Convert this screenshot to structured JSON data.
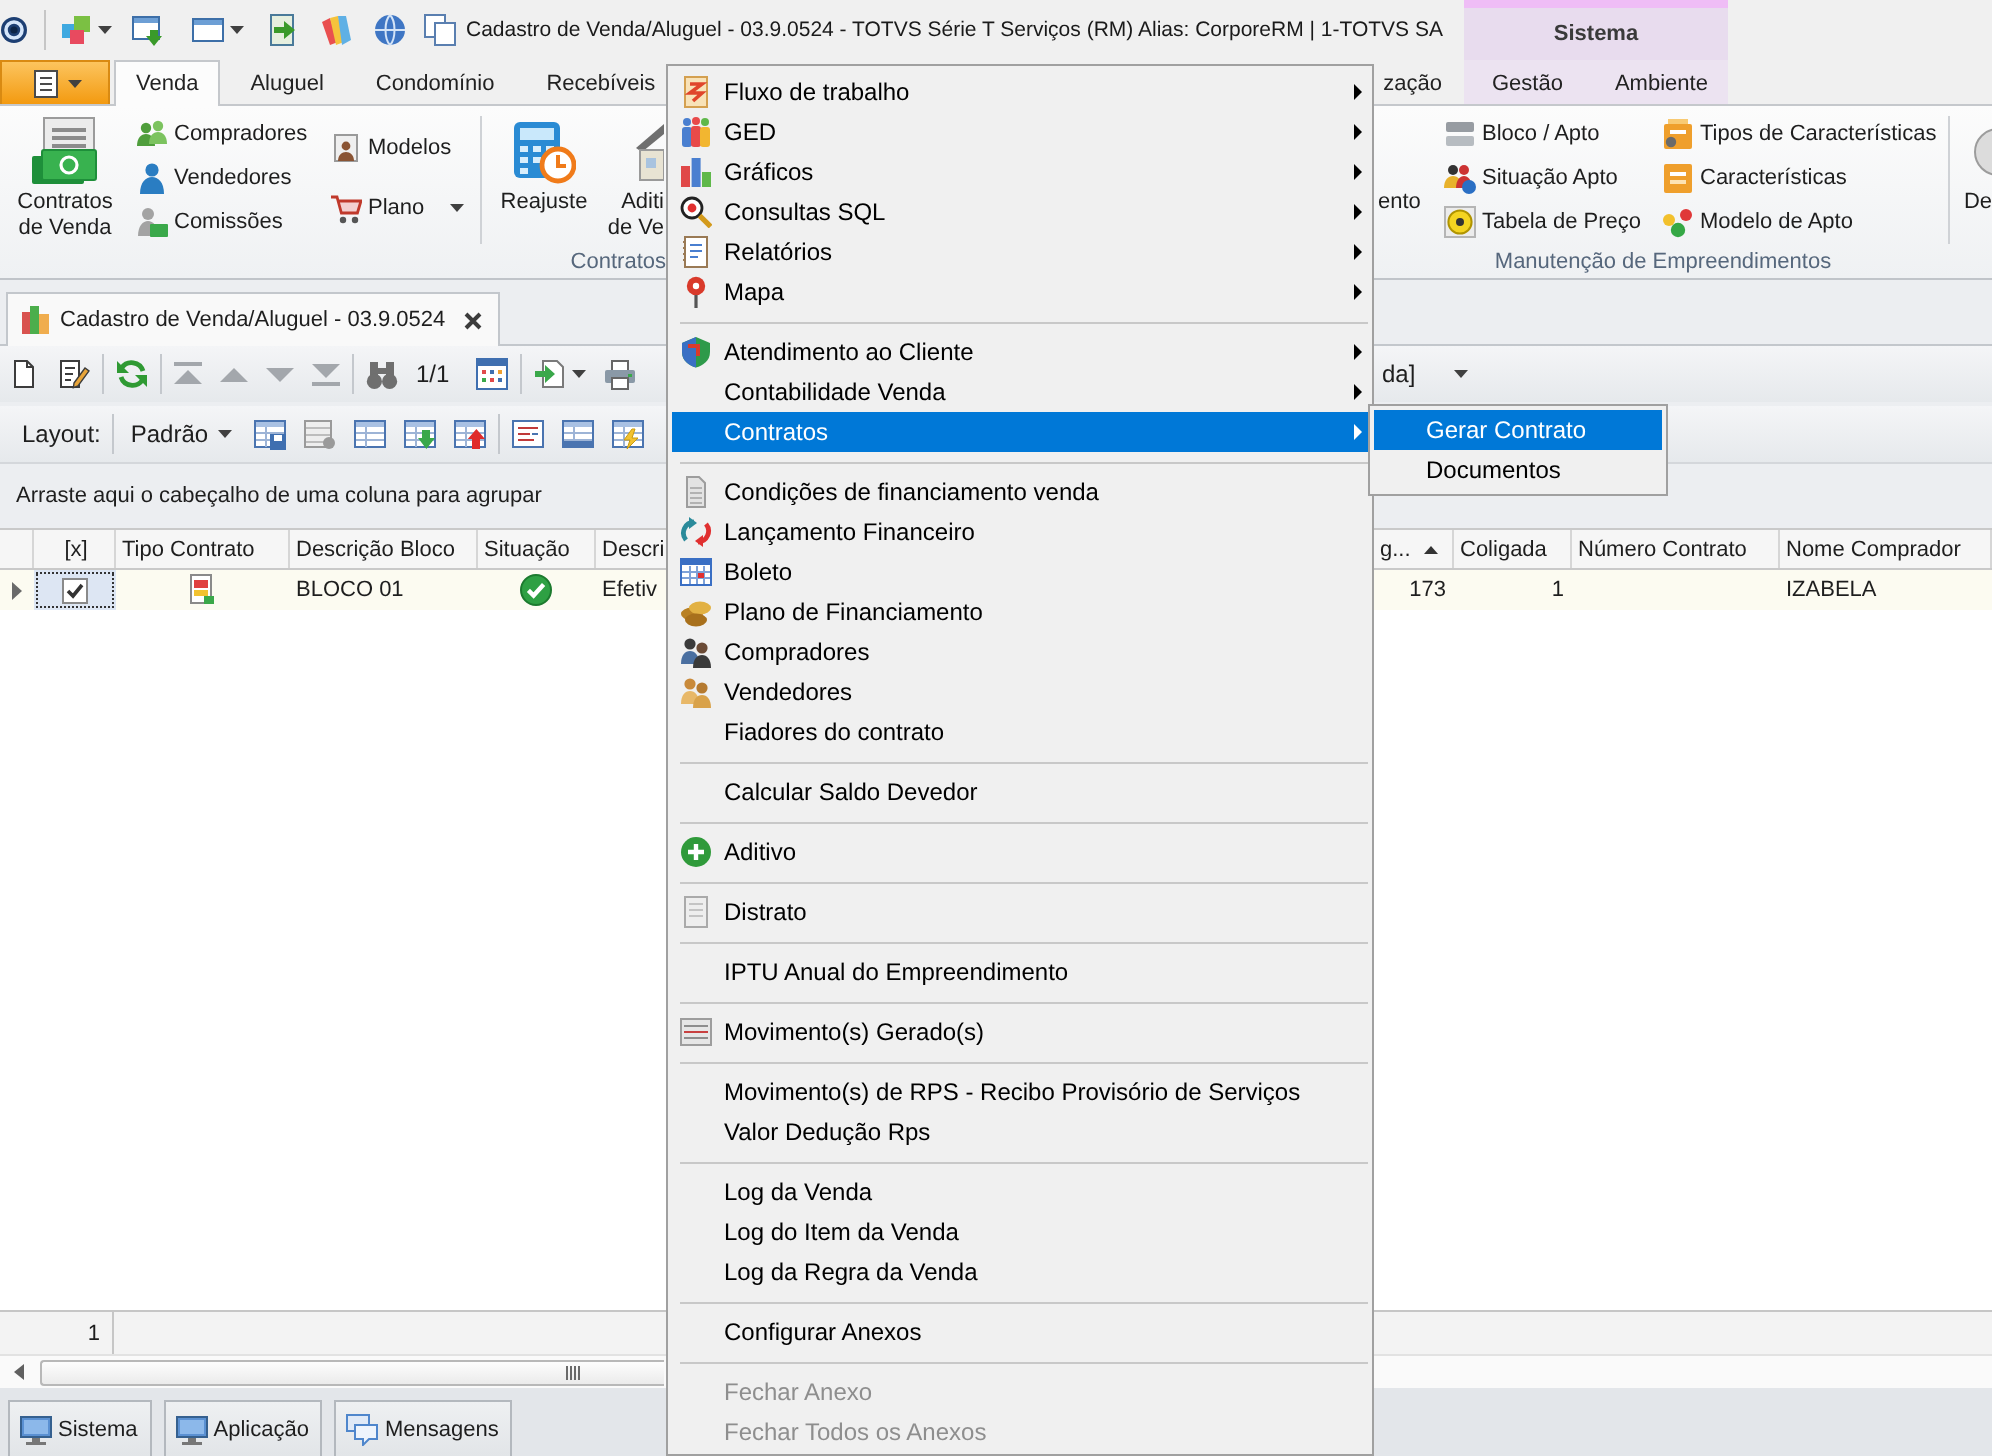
{
  "title_bar": {
    "title": "Cadastro de Venda/Aluguel - 03.9.0524 - TOTVS Série T Serviços (RM) Alias: CorporeRM | 1-TOTVS SA",
    "context_group": "Sistema"
  },
  "ribbon": {
    "tabs": [
      {
        "label": "Venda",
        "selected": true
      },
      {
        "label": "Aluguel",
        "selected": false
      },
      {
        "label": "Condomínio",
        "selected": false
      },
      {
        "label": "Recebíveis",
        "selected": false
      },
      {
        "label": "zação",
        "selected": false
      }
    ],
    "context_tabs": [
      {
        "label": "Gestão",
        "selected": false
      },
      {
        "label": "Ambiente",
        "selected": false
      }
    ],
    "groups": [
      {
        "columns": [
          {
            "kind": "large",
            "lines": [
              "Contratos",
              "de Venda"
            ]
          },
          {
            "kind": "small",
            "items": [
              {
                "label": "Compradores",
                "dropdown": false
              },
              {
                "label": "Vendedores",
                "dropdown": false
              },
              {
                "label": "Comissões",
                "dropdown": false
              }
            ]
          },
          {
            "kind": "small",
            "items": [
              {
                "label": "Modelos",
                "dropdown": false
              },
              {
                "label": "Plano",
                "dropdown": true
              }
            ]
          }
        ]
      },
      {
        "label": "Contratos",
        "columns": [
          {
            "kind": "large",
            "lines": [
              "Reajuste"
            ]
          },
          {
            "kind": "large",
            "lines": [
              "Aditi",
              "de Ve"
            ]
          }
        ]
      },
      {
        "label": "Manutenção de Empreendimentos",
        "columns": [
          {
            "kind": "large",
            "lines": [
              "ento"
            ]
          },
          {
            "kind": "small",
            "items": [
              {
                "label": "Bloco / Apto",
                "dropdown": false
              },
              {
                "label": "Situação Apto",
                "dropdown": false
              },
              {
                "label": "Tabela de Preço",
                "dropdown": false
              }
            ]
          },
          {
            "kind": "small",
            "items": [
              {
                "label": "Tipos de Características",
                "dropdown": false
              },
              {
                "label": "Características",
                "dropdown": false
              },
              {
                "label": "Modelo de Apto",
                "dropdown": false
              }
            ]
          }
        ]
      },
      {
        "columns": [
          {
            "kind": "large",
            "lines": [
              "De"
            ]
          }
        ]
      }
    ]
  },
  "document_tab": {
    "label": "Cadastro de Venda/Aluguel - 03.9.0524"
  },
  "toolbar": {
    "navigation": {
      "disabled": true
    },
    "record_counter": "1/1",
    "filter": "da]"
  },
  "layout_bar": {
    "label": "Layout:",
    "value": "Padrão"
  },
  "group_panel": {
    "hint": "Arraste aqui o cabeçalho de uma coluna para agrupar"
  },
  "grid": {
    "columns": [
      {
        "label": "[x]",
        "sorted": false
      },
      {
        "label": "Tipo Contrato",
        "sorted": false
      },
      {
        "label": "Descrição Bloco",
        "sorted": false
      },
      {
        "label": "Situação",
        "sorted": false
      },
      {
        "label": "Descri",
        "sorted": false
      },
      {
        "label": "g...",
        "sorted": true
      },
      {
        "label": "Coligada",
        "sorted": false
      },
      {
        "label": "Número Contrato",
        "sorted": false
      },
      {
        "label": "Nome Comprador",
        "sorted": false
      }
    ],
    "rows": [
      {
        "selected": true,
        "cells": [
          {
            "kind": "checkbox",
            "checked": true
          },
          {
            "kind": "icon"
          },
          {
            "kind": "text",
            "text": "BLOCO 01"
          },
          {
            "kind": "status"
          },
          {
            "kind": "text",
            "text": "Efetiv"
          },
          {
            "kind": "number",
            "text": "173"
          },
          {
            "kind": "number",
            "text": "1"
          },
          {
            "kind": "empty"
          },
          {
            "kind": "text",
            "text": "IZABELA"
          }
        ]
      }
    ],
    "footer": {
      "count": "1"
    }
  },
  "taskbar": [
    {
      "label": "Sistema"
    },
    {
      "label": "Aplicação"
    },
    {
      "label": "Mensagens"
    }
  ],
  "context_menu": {
    "groups": [
      {
        "items": [
          {
            "label": "Fluxo de trabalho",
            "has_submenu": true,
            "selected": false,
            "disabled": false
          },
          {
            "label": "GED",
            "has_submenu": true,
            "selected": false,
            "disabled": false
          },
          {
            "label": "Gráficos",
            "has_submenu": true,
            "selected": false,
            "disabled": false
          },
          {
            "label": "Consultas SQL",
            "has_submenu": true,
            "selected": false,
            "disabled": false
          },
          {
            "label": "Relatórios",
            "has_submenu": true,
            "selected": false,
            "disabled": false
          },
          {
            "label": "Mapa",
            "has_submenu": true,
            "selected": false,
            "disabled": false
          }
        ]
      },
      {
        "items": [
          {
            "label": "Atendimento ao Cliente",
            "has_submenu": true,
            "selected": false,
            "disabled": false
          },
          {
            "label": "Contabilidade Venda",
            "has_submenu": true,
            "selected": false,
            "disabled": false
          },
          {
            "label": "Contratos",
            "has_submenu": true,
            "selected": true,
            "disabled": false
          }
        ]
      },
      {
        "items": [
          {
            "label": "Condições de financiamento venda",
            "has_submenu": false,
            "selected": false,
            "disabled": false
          },
          {
            "label": "Lançamento Financeiro",
            "has_submenu": false,
            "selected": false,
            "disabled": false
          },
          {
            "label": "Boleto",
            "has_submenu": false,
            "selected": false,
            "disabled": false
          },
          {
            "label": "Plano de Financiamento",
            "has_submenu": false,
            "selected": false,
            "disabled": false
          },
          {
            "label": "Compradores",
            "has_submenu": false,
            "selected": false,
            "disabled": false
          },
          {
            "label": "Vendedores",
            "has_submenu": false,
            "selected": false,
            "disabled": false
          },
          {
            "label": "Fiadores do contrato",
            "has_submenu": false,
            "selected": false,
            "disabled": false
          }
        ]
      },
      {
        "items": [
          {
            "label": "Calcular Saldo Devedor",
            "has_submenu": false,
            "selected": false,
            "disabled": false
          }
        ]
      },
      {
        "items": [
          {
            "label": "Aditivo",
            "has_submenu": false,
            "selected": false,
            "disabled": false
          }
        ]
      },
      {
        "items": [
          {
            "label": "Distrato",
            "has_submenu": false,
            "selected": false,
            "disabled": false
          }
        ]
      },
      {
        "items": [
          {
            "label": "IPTU Anual do Empreendimento",
            "has_submenu": false,
            "selected": false,
            "disabled": false
          }
        ]
      },
      {
        "items": [
          {
            "label": "Movimento(s) Gerado(s)",
            "has_submenu": false,
            "selected": false,
            "disabled": false
          }
        ]
      },
      {
        "items": [
          {
            "label": "Movimento(s) de RPS - Recibo Provisório de Serviços",
            "has_submenu": false,
            "selected": false,
            "disabled": false
          },
          {
            "label": "Valor Dedução Rps",
            "has_submenu": false,
            "selected": false,
            "disabled": false
          }
        ]
      },
      {
        "items": [
          {
            "label": "Log da Venda",
            "has_submenu": false,
            "selected": false,
            "disabled": false
          },
          {
            "label": "Log do Item da Venda",
            "has_submenu": false,
            "selected": false,
            "disabled": false
          },
          {
            "label": "Log da Regra da Venda",
            "has_submenu": false,
            "selected": false,
            "disabled": false
          }
        ]
      },
      {
        "items": [
          {
            "label": "Configurar Anexos",
            "has_submenu": false,
            "selected": false,
            "disabled": false
          }
        ]
      },
      {
        "items": [
          {
            "label": "Fechar Anexo",
            "has_submenu": false,
            "selected": false,
            "disabled": true
          },
          {
            "label": "Fechar Todos os Anexos",
            "has_submenu": false,
            "selected": false,
            "disabled": true
          }
        ]
      }
    ],
    "submenu": {
      "items": [
        {
          "label": "Gerar Contrato",
          "selected": true
        },
        {
          "label": "Documentos",
          "selected": false
        }
      ]
    }
  }
}
